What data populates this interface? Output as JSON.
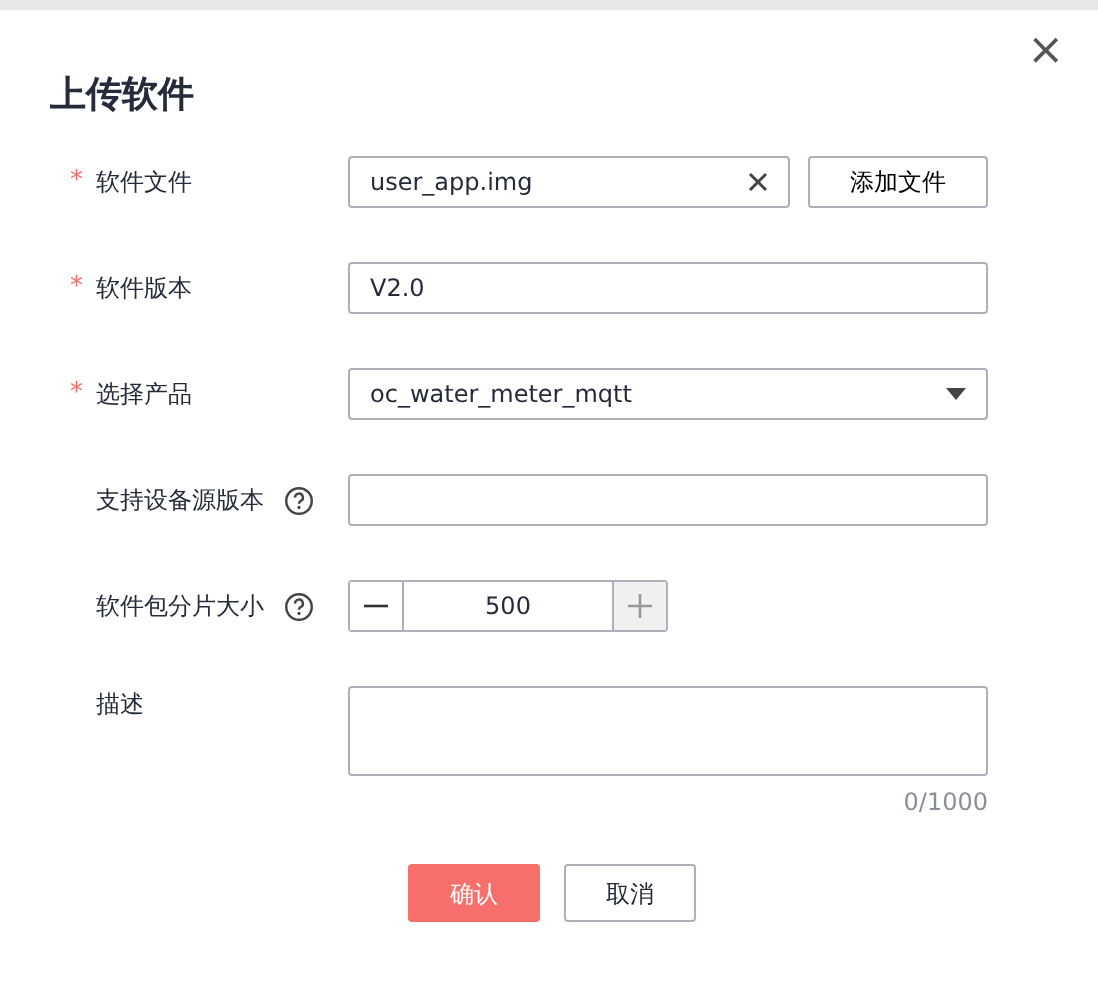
{
  "dialog": {
    "title": "上传软件",
    "close": "×"
  },
  "fields": [
    {
      "kind": "file",
      "label": "软件文件",
      "mark": "*",
      "value": "user_app.img",
      "action": "添加文件"
    },
    {
      "kind": "text",
      "label": "软件版本",
      "mark": "*",
      "value": "V2.0"
    },
    {
      "kind": "select",
      "label": "选择产品",
      "mark": "*",
      "value": "oc_water_meter_mqtt"
    },
    {
      "kind": "text",
      "label": "支持设备源版本",
      "help": true
    },
    {
      "kind": "stepper",
      "label": "软件包分片大小",
      "help": true,
      "value": "500",
      "minus_disabled": false,
      "plus_disabled": true
    },
    {
      "kind": "textarea",
      "label": "描述",
      "counter": "0/1000"
    }
  ],
  "buttons": [
    {
      "label": "确认",
      "kind": "primary"
    },
    {
      "label": "取消",
      "kind": "secondary"
    }
  ]
}
